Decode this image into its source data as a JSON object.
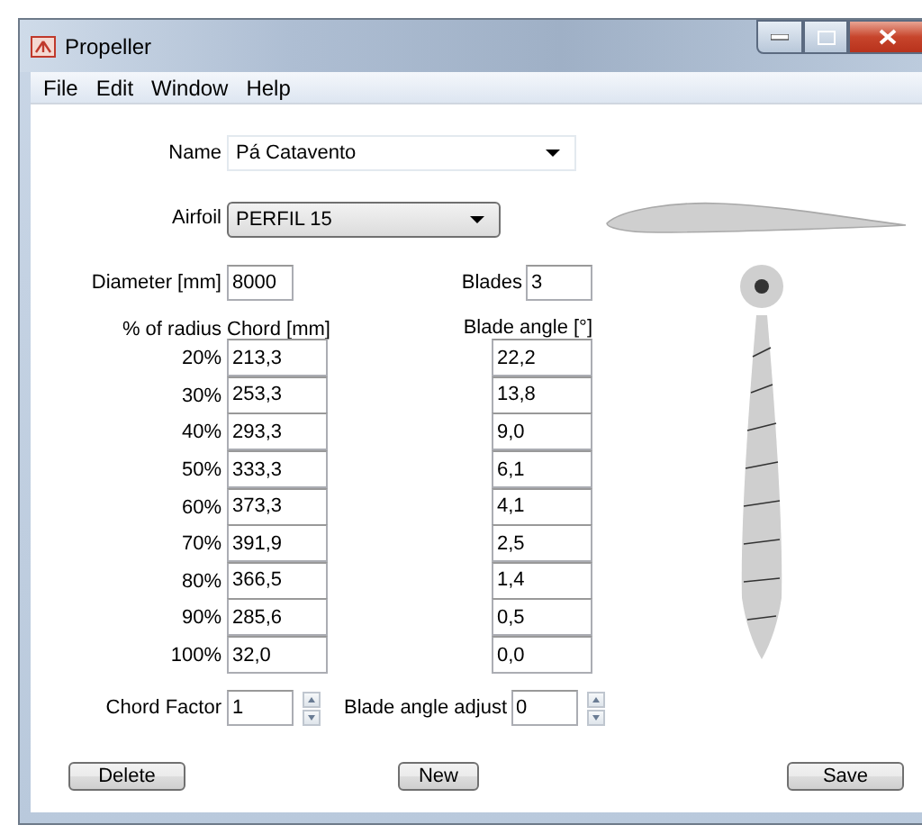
{
  "window": {
    "title": "Propeller"
  },
  "menu": [
    "File",
    "Edit",
    "Window",
    "Help"
  ],
  "name": {
    "label": "Name",
    "value": "Pá Catavento"
  },
  "airfoil": {
    "label": "Airfoil",
    "value": "PERFIL 15"
  },
  "diameter": {
    "label": "Diameter [mm]",
    "value": "8000"
  },
  "blades": {
    "label": "Blades",
    "value": "3"
  },
  "table": {
    "columns": [
      "% of radius",
      "Chord [mm]",
      "Blade angle [°]"
    ],
    "rows": [
      {
        "radius": "20%",
        "chord": "213,3",
        "angle": "22,2"
      },
      {
        "radius": "30%",
        "chord": "253,3",
        "angle": "13,8"
      },
      {
        "radius": "40%",
        "chord": "293,3",
        "angle": "9,0"
      },
      {
        "radius": "50%",
        "chord": "333,3",
        "angle": "6,1"
      },
      {
        "radius": "60%",
        "chord": "373,3",
        "angle": "4,1"
      },
      {
        "radius": "70%",
        "chord": "391,9",
        "angle": "2,5"
      },
      {
        "radius": "80%",
        "chord": "366,5",
        "angle": "1,4"
      },
      {
        "radius": "90%",
        "chord": "285,6",
        "angle": "0,5"
      },
      {
        "radius": "100%",
        "chord": "32,0",
        "angle": "0,0"
      }
    ]
  },
  "chord_factor": {
    "label": "Chord Factor",
    "value": "1"
  },
  "blade_angle_adjust": {
    "label": "Blade angle adjust",
    "value": "0"
  },
  "buttons": [
    "Delete",
    "New",
    "Save"
  ]
}
